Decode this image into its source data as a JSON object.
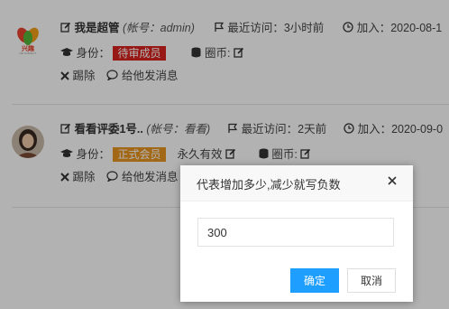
{
  "members": [
    {
      "name": "我是超管",
      "account": "(帐号：admin)",
      "last_visit": "最近访问：3小时前",
      "joined": "加入：2020-08-1",
      "identity_label": "身份：",
      "role": "待审成员",
      "role_color": "#d9231d",
      "validity": "",
      "coin_label": "圈币:",
      "kick_label": "踢除",
      "message_label": "给他发消息",
      "avatar_text": "兴趣",
      "avatar_sub": "RE SUBJECT"
    },
    {
      "name": "看看评委1号..",
      "account": "(帐号：看看)",
      "last_visit": "最近访问：2天前",
      "joined": "加入：2020-09-0",
      "identity_label": "身份：",
      "role": "正式会员",
      "role_color": "#e89520",
      "validity": "永久有效",
      "coin_label": "圈币:",
      "kick_label": "踢除",
      "message_label": "给他发消息"
    }
  ],
  "dialog": {
    "title": "代表增加多少,减少就写负数",
    "input_value": "300",
    "confirm_label": "确定",
    "cancel_label": "取消"
  }
}
